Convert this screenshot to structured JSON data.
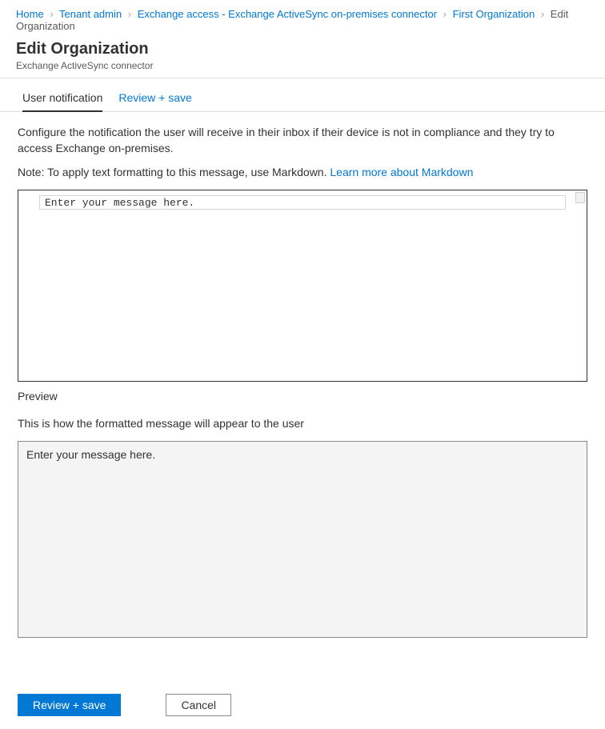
{
  "breadcrumb": {
    "items": [
      {
        "label": "Home"
      },
      {
        "label": "Tenant admin"
      },
      {
        "label": "Exchange access - Exchange ActiveSync on-premises connector"
      },
      {
        "label": "First Organization"
      }
    ],
    "current": "Edit Organization"
  },
  "header": {
    "title": "Edit Organization",
    "subtitle": "Exchange ActiveSync connector"
  },
  "tabs": [
    {
      "label": "User notification",
      "active": true
    },
    {
      "label": "Review + save",
      "active": false
    }
  ],
  "content": {
    "intro": "Configure the notification the user will receive in their inbox if their device is not in compliance and they try to access Exchange on-premises.",
    "note_prefix": "Note: To apply text formatting to this message, use Markdown. ",
    "note_link": "Learn more about Markdown",
    "editor_value": "Enter your message here.",
    "preview_label": "Preview",
    "preview_desc": "This is how the formatted message will appear to the user",
    "preview_value": "Enter your message here."
  },
  "footer": {
    "primary": "Review + save",
    "secondary": "Cancel"
  }
}
